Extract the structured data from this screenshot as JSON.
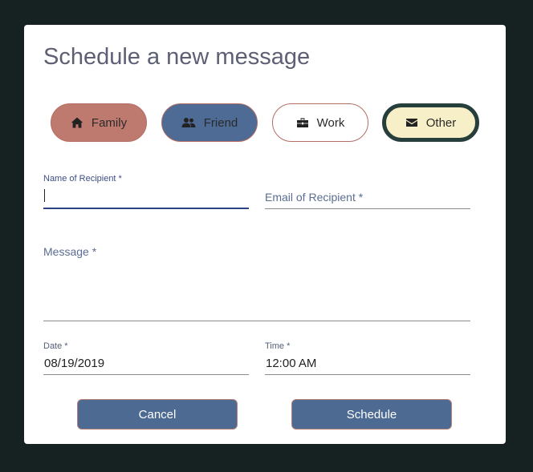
{
  "dialog": {
    "title": "Schedule a new message"
  },
  "categories": {
    "family": {
      "label": "Family",
      "icon": "home-icon",
      "color": "#bf7a70"
    },
    "friend": {
      "label": "Friend",
      "icon": "users-icon",
      "color": "#4d6b94"
    },
    "work": {
      "label": "Work",
      "icon": "briefcase-icon",
      "color": "#ffffff"
    },
    "other": {
      "label": "Other",
      "icon": "envelope-icon",
      "color": "#f6efc7",
      "selected": true
    }
  },
  "form": {
    "recipient_name": {
      "label": "Name of Recipient *",
      "value": ""
    },
    "recipient_email": {
      "label": "Email of Recipient *",
      "value": ""
    },
    "message": {
      "label": "Message *",
      "value": ""
    },
    "date": {
      "label": "Date *",
      "value": "08/19/2019"
    },
    "time": {
      "label": "Time *",
      "value": "12:00 AM"
    }
  },
  "actions": {
    "cancel_label": "Cancel",
    "schedule_label": "Schedule",
    "button_color": "#4d6a92"
  }
}
